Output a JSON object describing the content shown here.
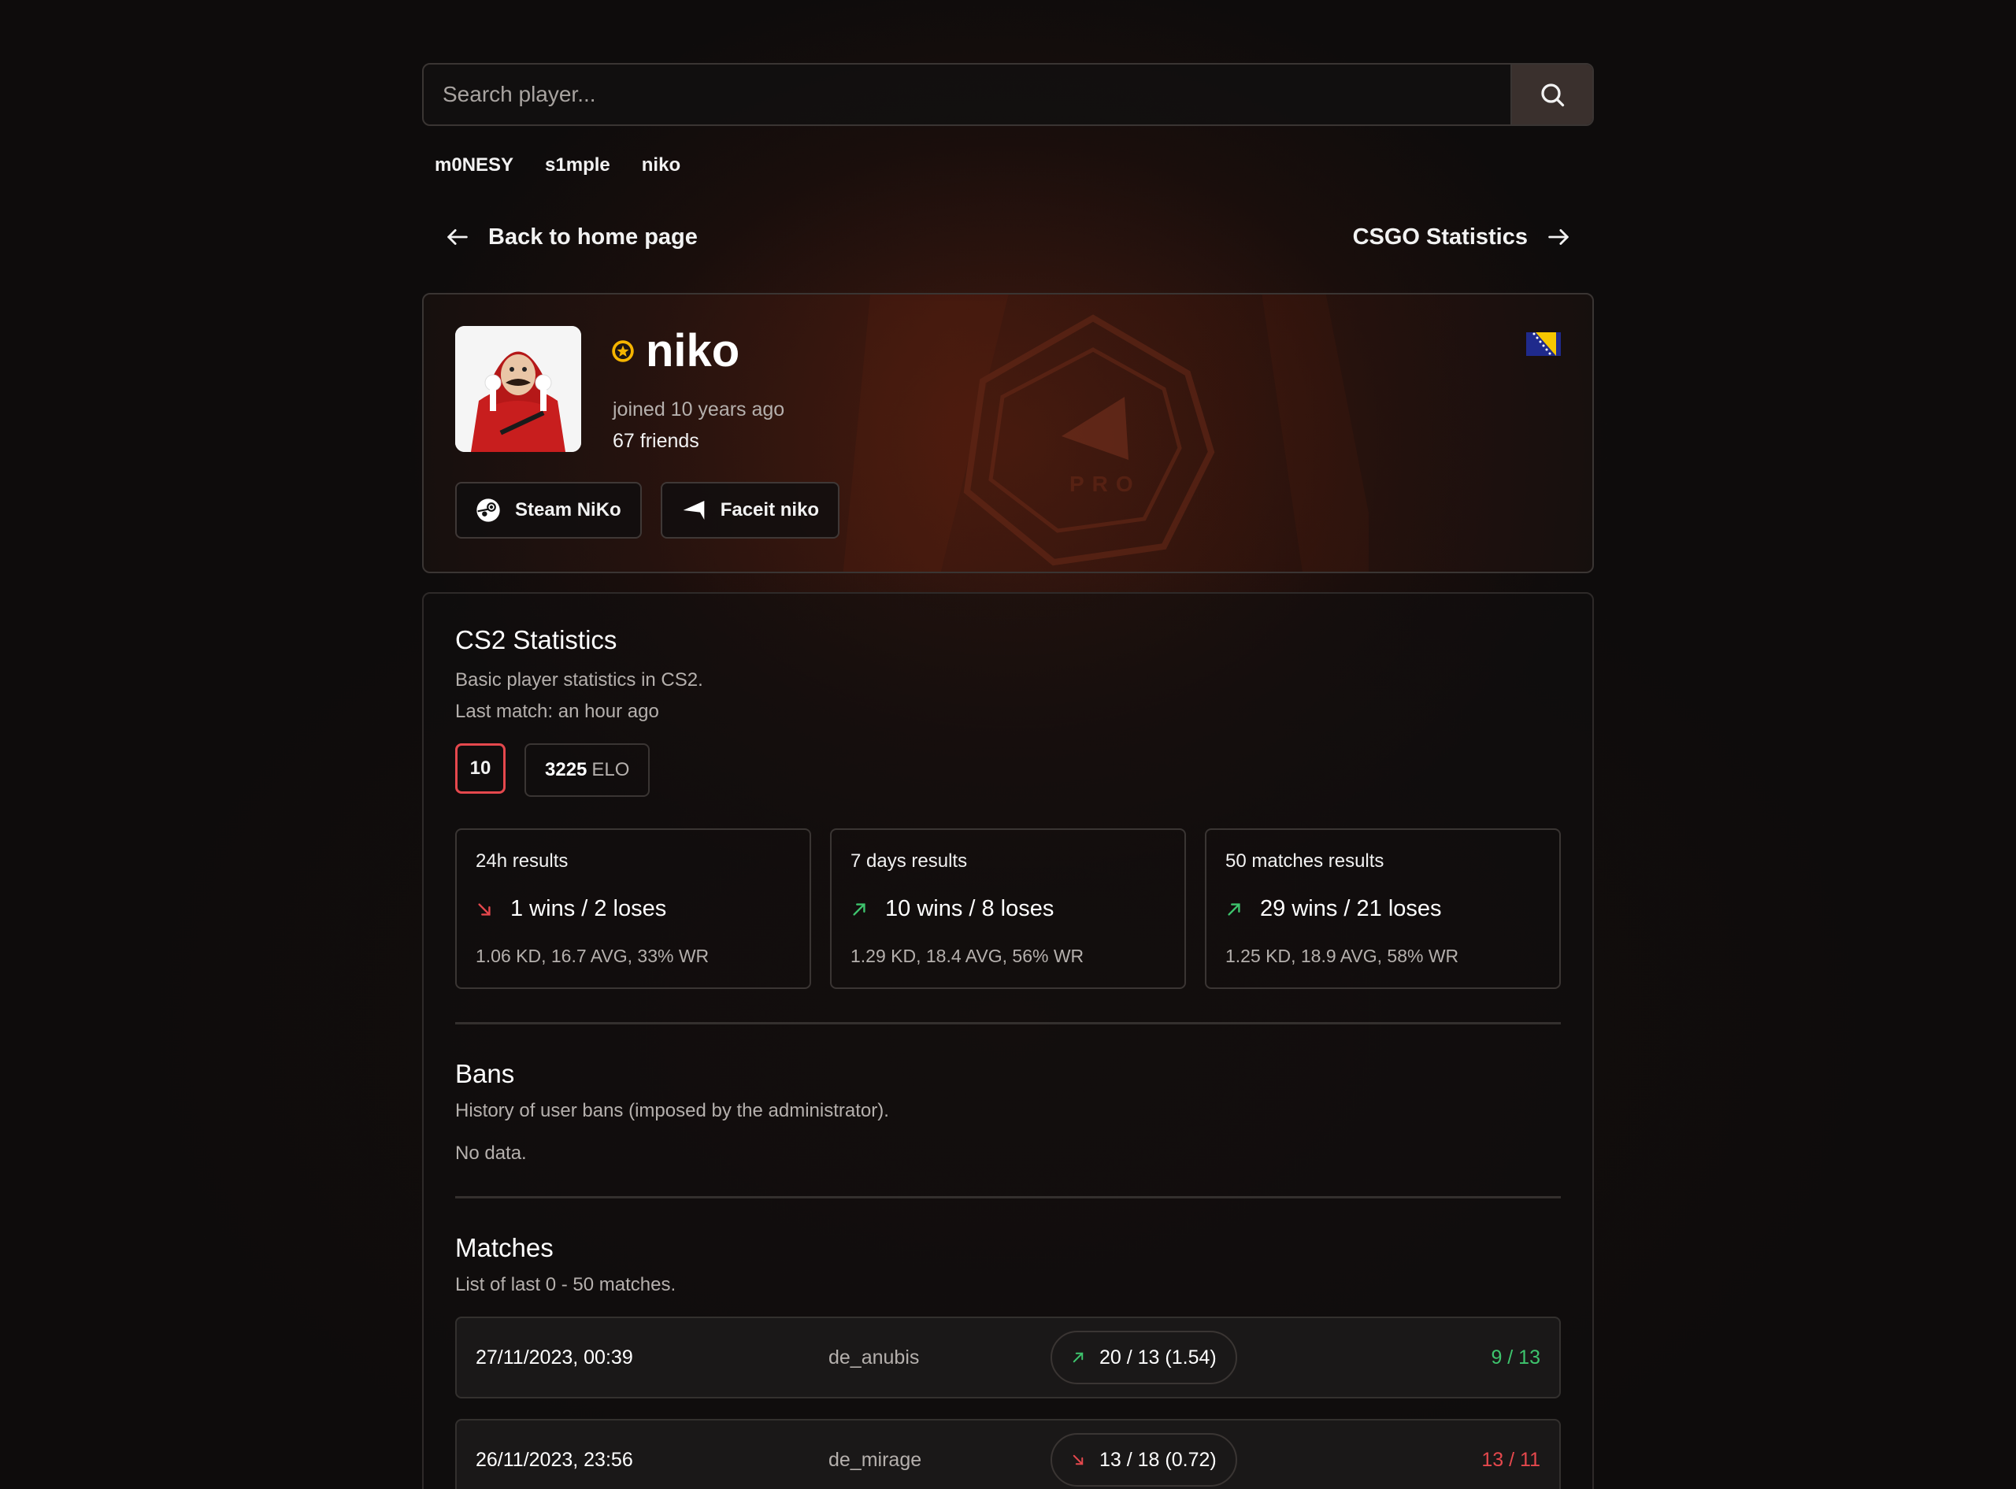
{
  "search": {
    "placeholder": "Search player..."
  },
  "quick_players": [
    "m0NESY",
    "s1mple",
    "niko"
  ],
  "nav": {
    "back_label": "Back to home page",
    "csgo_label": "CSGO Statistics"
  },
  "profile": {
    "name": "niko",
    "joined": "joined 10 years ago",
    "friends": "67 friends",
    "steam_label": "Steam NiKo",
    "faceit_label": "Faceit niko",
    "pro_badge_text": "PRO",
    "country_flag": "bosnia-flag-icon"
  },
  "cs2": {
    "title": "CS2 Statistics",
    "desc": "Basic player statistics in CS2.",
    "last_match": "Last match: an hour ago",
    "level": "10",
    "elo_value": "3225",
    "elo_unit": "ELO",
    "results": [
      {
        "title": "24h results",
        "trend": "down",
        "wl": "1 wins / 2 loses",
        "stats": "1.06 KD, 16.7 AVG, 33% WR"
      },
      {
        "title": "7 days results",
        "trend": "up",
        "wl": "10 wins / 8 loses",
        "stats": "1.29 KD, 18.4 AVG, 56% WR"
      },
      {
        "title": "50 matches results",
        "trend": "up",
        "wl": "29 wins / 21 loses",
        "stats": "1.25 KD, 18.9 AVG, 58% WR"
      }
    ]
  },
  "bans": {
    "title": "Bans",
    "desc": "History of user bans (imposed by the administrator).",
    "empty": "No data."
  },
  "matches": {
    "title": "Matches",
    "desc": "List of last 0 - 50 matches.",
    "rows": [
      {
        "date": "27/11/2023, 00:39",
        "map": "de_anubis",
        "trend": "up",
        "kd": "20 / 13 (1.54)",
        "score": "9 / 13",
        "result": "win"
      },
      {
        "date": "26/11/2023, 23:56",
        "map": "de_mirage",
        "trend": "down",
        "kd": "13 / 18 (0.72)",
        "score": "13 / 11",
        "result": "loss"
      }
    ]
  },
  "colors": {
    "win": "#3ec46d",
    "loss": "#e5484d",
    "accent": "#e5484d",
    "star": "#f5b400"
  }
}
